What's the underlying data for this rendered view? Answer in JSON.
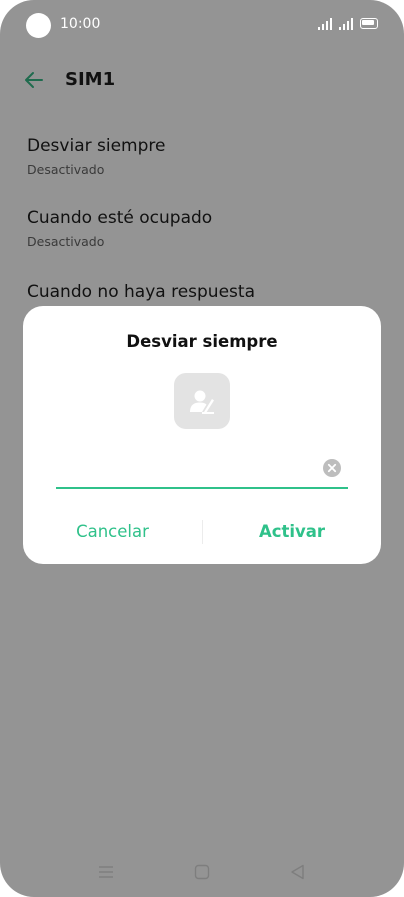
{
  "status_bar": {
    "time": "10:00"
  },
  "header": {
    "title": "SIM1",
    "back_icon": "arrow-left-icon"
  },
  "settings": {
    "items": [
      {
        "title": "Desviar siempre",
        "subtitle": "Desactivado"
      },
      {
        "title": "Cuando esté ocupado",
        "subtitle": "Desactivado"
      },
      {
        "title": "Cuando no haya respuesta"
      }
    ]
  },
  "dialog": {
    "title": "Desviar siempre",
    "contact_icon": "contact-picker-icon",
    "input_value": "",
    "cancel_label": "Cancelar",
    "activate_label": "Activar"
  },
  "colors": {
    "accent": "#2fc18a",
    "scrim": "#949494",
    "dialog_bg": "#ffffff"
  },
  "nav_bar": {
    "icons": [
      "menu-icon",
      "home-square-icon",
      "back-triangle-icon"
    ]
  }
}
